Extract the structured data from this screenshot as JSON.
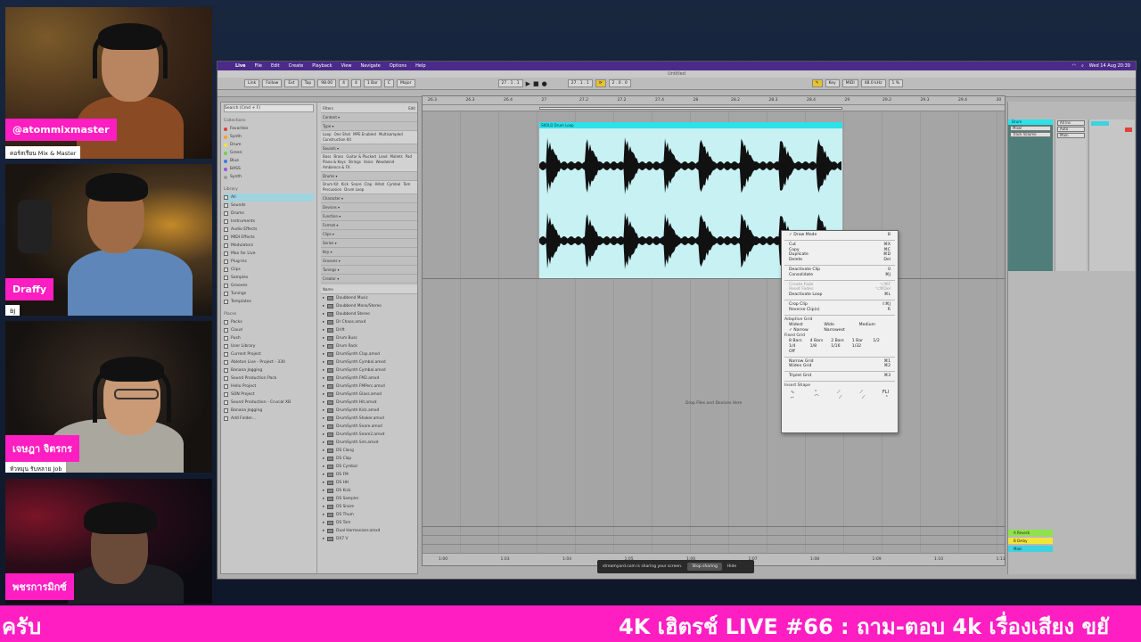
{
  "participants": [
    {
      "name": "@atommixmaster",
      "subtitle": "คอร์สเรียน Mix & Master"
    },
    {
      "name": "Draffy",
      "subtitle": "BJ"
    },
    {
      "name": "เจษฎา จิตรกร",
      "subtitle": "หัวหมุน รับหลาย Job"
    },
    {
      "name": "พชรการมิกซ์",
      "subtitle": ""
    }
  ],
  "menubar": {
    "app": "Live",
    "items": [
      "File",
      "Edit",
      "Create",
      "Playback",
      "View",
      "Navigate",
      "Options",
      "Help"
    ],
    "clock": "Wed 14 Aug 20:39"
  },
  "window_title": "Untitled",
  "transport": {
    "link": "Link",
    "follow": "Follow",
    "ext": "Ext",
    "tap": "Tap",
    "tempo": "98.00",
    "sig_num": "4",
    "sig_den": "4",
    "quant": "1 Bar",
    "position": "27 . 1 . 1",
    "loop_start": "27 . 1 . 1",
    "loop_len": "2 . 0 . 0",
    "key": "Key",
    "midi": "MIDI",
    "sample_rate": "48.0 kHz",
    "cpu": "1 %"
  },
  "scale": {
    "root": "C",
    "mode": "Major"
  },
  "browser": {
    "search_placeholder": "Search (Cmd + F)",
    "collections_header": "Collections",
    "collections": [
      {
        "label": "Favorites",
        "color": "#e0413b"
      },
      {
        "label": "Synth",
        "color": "#f0a32c"
      },
      {
        "label": "Drum",
        "color": "#f2e33a"
      },
      {
        "label": "Green",
        "color": "#6ad34b"
      },
      {
        "label": "Blue",
        "color": "#3c7de0"
      },
      {
        "label": "BASS",
        "color": "#9b55d8"
      },
      {
        "label": "Synth",
        "color": "#9a9a9a"
      }
    ],
    "library_header": "Library",
    "library": [
      "All",
      "Sounds",
      "Drums",
      "Instruments",
      "Audio Effects",
      "MIDI Effects",
      "Modulators",
      "Max for Live",
      "Plug-Ins",
      "Clips",
      "Samples",
      "Grooves",
      "Tunings",
      "Templates"
    ],
    "places_header": "Places",
    "places": [
      "Packs",
      "Cloud",
      "Push",
      "User Library",
      "Current Project",
      "Ableton Live - Project - 330",
      "Banana Jogging",
      "Sound Production Pack",
      "Hello Project",
      "SON Project",
      "Sound Production - Crucial XB",
      "Banana Jogging",
      "Add Folder..."
    ],
    "filters_label": "Filters",
    "edit_label": "Edit",
    "filter_groups": [
      {
        "title": "Content",
        "tags": []
      },
      {
        "title": "Type",
        "tags": [
          "Loop",
          "One Shot",
          "MPE Enabled",
          "Multisampled",
          "Construction Kit"
        ]
      },
      {
        "title": "Sounds",
        "tags": [
          "Bass",
          "Brass",
          "Guitar & Plucked",
          "Lead",
          "Mallets",
          "Pad",
          "Piano & Keys",
          "Strings",
          "Voice",
          "Woodwind",
          "Ambience & FX"
        ]
      },
      {
        "title": "Drums",
        "tags": [
          "Drum Kit",
          "Kick",
          "Snare",
          "Clap",
          "Hihat",
          "Cymbal",
          "Tom",
          "Percussion",
          "Drum Loop"
        ]
      },
      {
        "title": "Character",
        "tags": []
      },
      {
        "title": "Devices",
        "tags": []
      },
      {
        "title": "Function",
        "tags": []
      },
      {
        "title": "Format",
        "tags": []
      },
      {
        "title": "Clips",
        "tags": []
      },
      {
        "title": "Series",
        "tags": []
      },
      {
        "title": "Key",
        "tags": []
      },
      {
        "title": "Grooves",
        "tags": []
      },
      {
        "title": "Tunings",
        "tags": []
      },
      {
        "title": "Creator",
        "tags": []
      }
    ],
    "name_header": "Name",
    "files": [
      "Doubbend Music",
      "Doubbend Mono/Stereo",
      "Doubbend Stereo",
      "Dr Chaos.amxd",
      "Drift",
      "Drum Buss",
      "Drum Rack",
      "DrumSynth Clap.amxd",
      "DrumSynth Cymbal.amxd",
      "DrumSynth Cymbal.amxd",
      "DrumSynth FM2.amxd",
      "DrumSynth FMPerc.amxd",
      "DrumSynth Glass.amxd",
      "DrumSynth Hit.amxd",
      "DrumSynth Kick.amxd",
      "DrumSynth Shaker.amxd",
      "DrumSynth Snare.amxd",
      "DrumSynth Snare2.amxd",
      "DrumSynth Sim.amxd",
      "DS Clang",
      "DS Clap",
      "DS Cymbal",
      "DS FM",
      "DS HH",
      "DS Kick",
      "DS Sampler",
      "DS Snare",
      "DS Thum",
      "DS Tom",
      "Dual Harmonizer.amxd",
      "DX7 V"
    ]
  },
  "arrangement": {
    "ruler_top": [
      "26.3",
      "26.3",
      "26.4",
      "27",
      "27.2",
      "27.2",
      "27.4",
      "28",
      "28.2",
      "28.3",
      "28.4",
      "29",
      "29.2",
      "29.3",
      "29.4",
      "30"
    ],
    "ruler_bottom": [
      "1:00",
      "1:03",
      "1:04",
      "1:05",
      "1:06",
      "1:07",
      "1:08",
      "1:09",
      "1:10",
      "1:11"
    ],
    "clip_name": "SKOLD Drum Loop",
    "drop_hint": "Drop Files and Devices Here"
  },
  "context_menu": [
    {
      "label": "Draw Mode",
      "shortcut": "B",
      "checked": true
    },
    {
      "sep": true
    },
    {
      "label": "Cut",
      "shortcut": "⌘X"
    },
    {
      "label": "Copy",
      "shortcut": "⌘C"
    },
    {
      "label": "Duplicate",
      "shortcut": "⌘D"
    },
    {
      "label": "Delete",
      "shortcut": "Del"
    },
    {
      "sep": true
    },
    {
      "label": "Deactivate Clip",
      "shortcut": "0"
    },
    {
      "label": "Consolidate",
      "shortcut": "⌘J"
    },
    {
      "sep": true
    },
    {
      "label": "Create Fade",
      "shortcut": "⌥⌘F",
      "disabled": true
    },
    {
      "label": "Reset Fades",
      "shortcut": "⌥⌘Del",
      "disabled": true
    },
    {
      "label": "Deactivate Loop",
      "shortcut": "⌘L"
    },
    {
      "sep": true
    },
    {
      "label": "Crop Clip",
      "shortcut": "⇧⌘J"
    },
    {
      "label": "Reverse Clip(s)",
      "shortcut": "R"
    },
    {
      "sep": true
    },
    {
      "title": "Adaptive Grid"
    },
    {
      "grid": [
        "Widest",
        "Wide",
        "Medium"
      ]
    },
    {
      "grid": [
        "✓ Narrow",
        "Narrowest",
        ""
      ]
    },
    {
      "title": "Fixed Grid"
    },
    {
      "grid": [
        "8 Bars",
        "4 Bars",
        "2 Bars",
        "1 Bar",
        "1/2"
      ]
    },
    {
      "grid": [
        "1/4",
        "1/8",
        "1/16",
        "1/32",
        ""
      ]
    },
    {
      "grid": [
        "Off",
        "",
        "",
        "",
        ""
      ]
    },
    {
      "sep": true
    },
    {
      "label": "Narrow Grid",
      "shortcut": "⌘1"
    },
    {
      "label": "Widen Grid",
      "shortcut": "⌘2"
    },
    {
      "sep": true
    },
    {
      "label": "Triplet Grid",
      "shortcut": "⌘3"
    },
    {
      "sep": true
    },
    {
      "title": "Insert Shape"
    },
    {
      "shapes": [
        "∿",
        "⌃",
        "⟋",
        "⟋",
        "FLI"
      ]
    },
    {
      "shapes": [
        "⌐",
        "⌒",
        "⟋",
        "⟋",
        "⌃"
      ]
    }
  ],
  "mixer": {
    "track_name": "Drum",
    "fields": [
      "Mixer",
      "Track Volume"
    ],
    "in_all": "All Ins",
    "auto": "Auto",
    "main": "Main",
    "returns": [
      {
        "label": "A Reverb",
        "color": "#8fe34a"
      },
      {
        "label": "B Delay",
        "color": "#f0e63a"
      },
      {
        "label": "Main",
        "color": "#3dd3e0"
      }
    ]
  },
  "share_notice": {
    "text": "streamyard.com is sharing your screen.",
    "stop": "Stop sharing",
    "hide": "Hide"
  },
  "ticker": {
    "left": "ครับ",
    "right": "4K เฮิตรช์ LIVE #66 : ถาม-ตอบ 4k เรื่องเสียง ขยั"
  },
  "colors": {
    "accent": "#ff1ec2",
    "clip": "#2ee1e8",
    "menubar": "#4b2a8a"
  }
}
